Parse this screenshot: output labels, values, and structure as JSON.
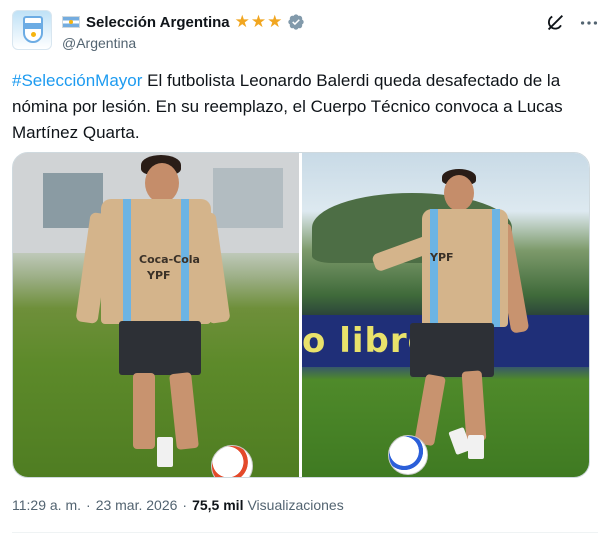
{
  "account": {
    "display_name": "Selección Argentina",
    "stars": "★★★",
    "handle": "@Argentina",
    "avatar_icon": "afa-crest-icon",
    "flag_icon": "argentina-flag-icon",
    "verified_icon": "verified-badge-icon"
  },
  "actions": {
    "grok_icon": "grok-icon",
    "more_icon": "more-options-icon"
  },
  "tweet": {
    "hashtag": "#SelecciónMayor",
    "body": " El futbolista Leonardo Balerdi queda desafectado de la nómina por lesión. En su reemplazo, el Cuerpo Técnico convoca a Lucas Martínez Quarta."
  },
  "media": {
    "photos": [
      {
        "jersey_text_1": "Coca-Cola",
        "jersey_text_2": "YPF"
      },
      {
        "jersey_text_1": "YPF",
        "banner_text": "o libre"
      }
    ]
  },
  "meta": {
    "time": "11:29 a. m.",
    "separator": "·",
    "date": "23 mar. 2026",
    "views_count": "75,5 mil",
    "views_label": "Visualizaciones"
  },
  "colors": {
    "accent": "#1d9bf0",
    "stars": "#f1a620",
    "muted": "#536471"
  }
}
